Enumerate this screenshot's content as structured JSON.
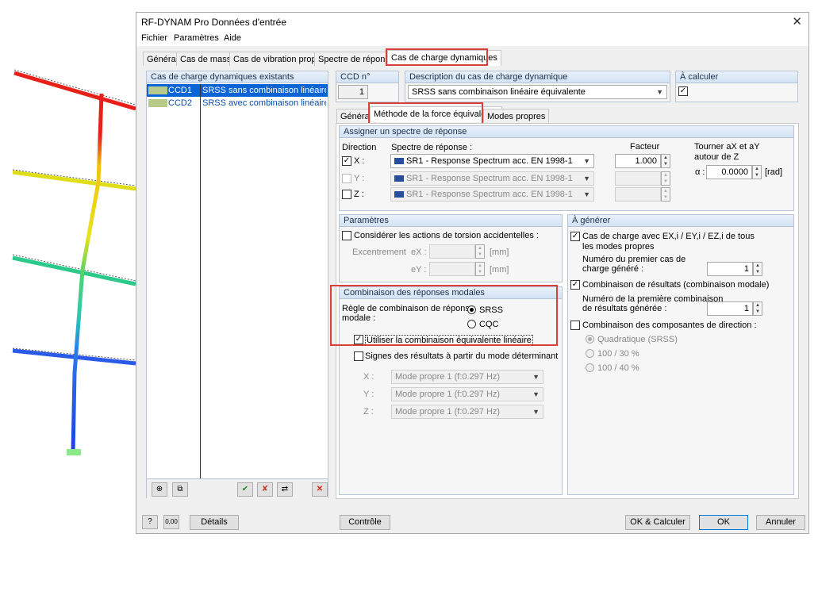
{
  "title": "RF-DYNAM Pro Données d'entrée",
  "menu": [
    "Fichier",
    "Paramètres",
    "Aide"
  ],
  "tabs": [
    "Général",
    "Cas de masse",
    "Cas de vibration propre",
    "Spectre de réponse",
    "Cas de charge dynamiques"
  ],
  "left_panel": {
    "title": "Cas de charge dynamiques existants",
    "items": [
      {
        "id": "CCD1",
        "desc": "SRSS sans combinaison linéaire équiva"
      },
      {
        "id": "CCD2",
        "desc": "SRSS avec combinaison linéaire équiva"
      }
    ]
  },
  "ccd": {
    "label": "CCD n°",
    "value": "1"
  },
  "description": {
    "label": "Description du cas de charge dynamique",
    "value": "SRSS sans combinaison linéaire équivalente"
  },
  "calc": {
    "label": "À calculer"
  },
  "subtabs": [
    "Général",
    "Méthode de la force équivalente",
    "Modes propres"
  ],
  "spectre": {
    "title": "Assigner un spectre de réponse",
    "direction_label": "Direction",
    "spectre_label": "Spectre de réponse :",
    "facteur_label": "Facteur",
    "rows": [
      {
        "dir": "X :",
        "spectrum": "SR1 - Response Spectrum acc. EN 1998-1",
        "factor": "1.000"
      },
      {
        "dir": "Y :",
        "spectrum": "SR1 - Response Spectrum acc. EN 1998-1",
        "factor": ""
      },
      {
        "dir": "Z :",
        "spectrum": "SR1 - Response Spectrum acc. EN 1998-1",
        "factor": ""
      }
    ],
    "rotate_label_1": "Tourner aX et aY",
    "rotate_label_2": "autour de Z",
    "alpha_label": "α :",
    "alpha_value": "0.0000",
    "alpha_unit": "[rad]"
  },
  "parametres": {
    "title": "Paramètres",
    "torsion": "Considérer les actions de torsion accidentelles :",
    "excentrement": "Excentrement",
    "ex": "eX :",
    "ey": "eY :",
    "unit": "[mm]"
  },
  "combinaison": {
    "title": "Combinaison des réponses modales",
    "rule_1": "Règle de combinaison de réponse",
    "rule_2": "modale :",
    "srss": "SRSS",
    "cqc": "CQC",
    "linear": "Utiliser la combinaison équivalente linéaire",
    "signs": "Signes des résultats à partir du mode déterminant",
    "modes": [
      {
        "axis": "X :",
        "value": "Mode propre 1 (f:0.297 Hz)"
      },
      {
        "axis": "Y :",
        "value": "Mode propre 1 (f:0.297 Hz)"
      },
      {
        "axis": "Z :",
        "value": "Mode propre 1 (f:0.297 Hz)"
      }
    ]
  },
  "generer": {
    "title": "À générer",
    "cc_line1": "Cas de charge avec  EX,i / EY,i  / EZ,i de tous",
    "cc_line2": "les modes propres",
    "first_line1": "Numéro du premier cas de",
    "first_line2": "charge généré :",
    "first_value": "1",
    "res_comb": "Combinaison de résultats (combinaison modale)",
    "res_line1": "Numéro de la première combinaison",
    "res_line2": "de résultats générée :",
    "res_value": "1",
    "dir_comb": "Combinaison des composantes de direction :",
    "quad": "Quadratique (SRSS)",
    "r100_30": "100 / 30 %",
    "r100_40": "100 / 40 %"
  },
  "buttons": {
    "details": "Détails",
    "controle": "Contrôle",
    "ok_calc": "OK & Calculer",
    "ok": "OK",
    "annuler": "Annuler",
    "num_icon": "0,00"
  },
  "colors": {
    "accent_red": "#d9403b",
    "group_border": "#b8c4d4",
    "ok_border": "#0078d7"
  }
}
